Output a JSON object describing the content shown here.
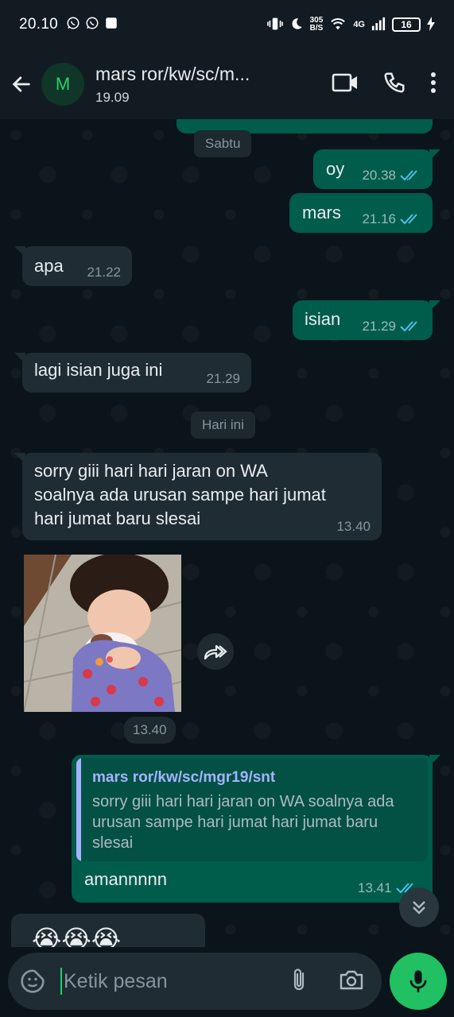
{
  "status_bar": {
    "time": "20.10",
    "net_speed_value": "305",
    "net_speed_unit": "B/S",
    "network": "4G",
    "battery": "16"
  },
  "header": {
    "avatar_letter": "M",
    "contact_name": "mars ror/kw/sc/m...",
    "subtitle": "19.09"
  },
  "chat": {
    "date_chips": [
      "Sabtu",
      "Hari ini"
    ],
    "messages": [
      {
        "direction": "out",
        "text": "oy",
        "time": "20.38"
      },
      {
        "direction": "out",
        "text": "mars",
        "time": "21.16"
      },
      {
        "direction": "in",
        "text": "apa",
        "time": "21.22"
      },
      {
        "direction": "out",
        "text": "isian",
        "time": "21.29"
      },
      {
        "direction": "in",
        "text": "lagi isian juga ini",
        "time": "21.29"
      },
      {
        "direction": "in",
        "text": "sorry giii hari hari jaran on WA soalnya ada urusan sampe hari jumat hari jumat baru slesai",
        "time": "13.40"
      },
      {
        "direction": "in",
        "type": "image",
        "time": "13.40"
      },
      {
        "direction": "out",
        "reply_to_name": "mars ror/kw/sc/mgr19/snt",
        "reply_to_text": "sorry giii hari hari jaran on WA soalnya ada urusan sampe hari jumat hari jumat baru slesai",
        "text": "amannnnn",
        "time": "13.41"
      },
      {
        "direction": "in",
        "text": "😭😭😭"
      }
    ]
  },
  "composer": {
    "placeholder": "Ketik pesan"
  },
  "colors": {
    "background": "#0b141a",
    "bubble_in": "#202c33",
    "bubble_out": "#005c4b",
    "accent": "#25d366",
    "read_tick": "#53bdeb"
  }
}
